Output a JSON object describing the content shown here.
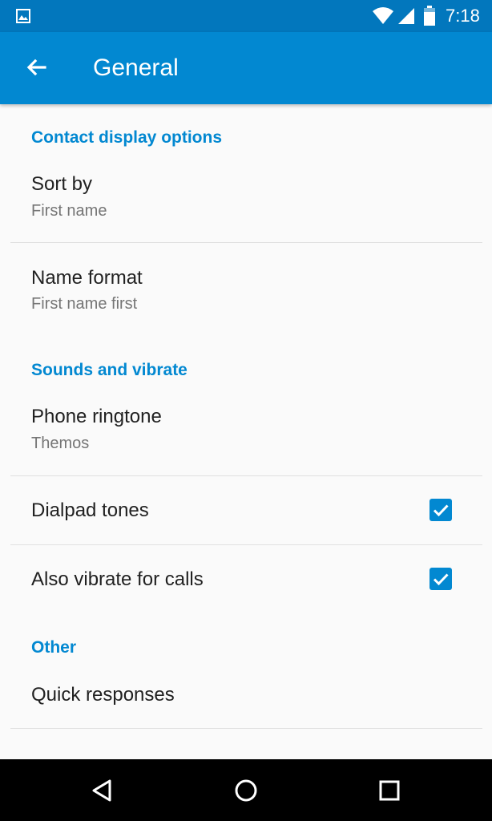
{
  "status_bar": {
    "time": "7:18",
    "icons": [
      "gallery-notification-icon",
      "wifi-icon",
      "cell-signal-icon",
      "battery-icon"
    ]
  },
  "app_bar": {
    "back_icon": "arrow-back-icon",
    "title": "General"
  },
  "sections": {
    "contact_display": {
      "header": "Contact display options",
      "sort_by": {
        "title": "Sort by",
        "summary": "First name"
      },
      "name_format": {
        "title": "Name format",
        "summary": "First name first"
      }
    },
    "sounds": {
      "header": "Sounds and vibrate",
      "phone_ringtone": {
        "title": "Phone ringtone",
        "summary": "Themos"
      },
      "dialpad_tones": {
        "title": "Dialpad tones",
        "checked": true
      },
      "vibrate_for_calls": {
        "title": "Also vibrate for calls",
        "checked": true
      }
    },
    "other": {
      "header": "Other",
      "quick_responses": {
        "title": "Quick responses"
      }
    }
  },
  "nav_bar": {
    "icons": [
      "back-triangle-icon",
      "home-circle-icon",
      "recents-square-icon"
    ]
  },
  "colors": {
    "status_bar": "#0277bd",
    "app_bar": "#0288d1",
    "accent": "#0288d1",
    "background": "#fafafa",
    "primary_text": "#212121",
    "secondary_text": "#757575",
    "nav_bar": "#000000"
  }
}
